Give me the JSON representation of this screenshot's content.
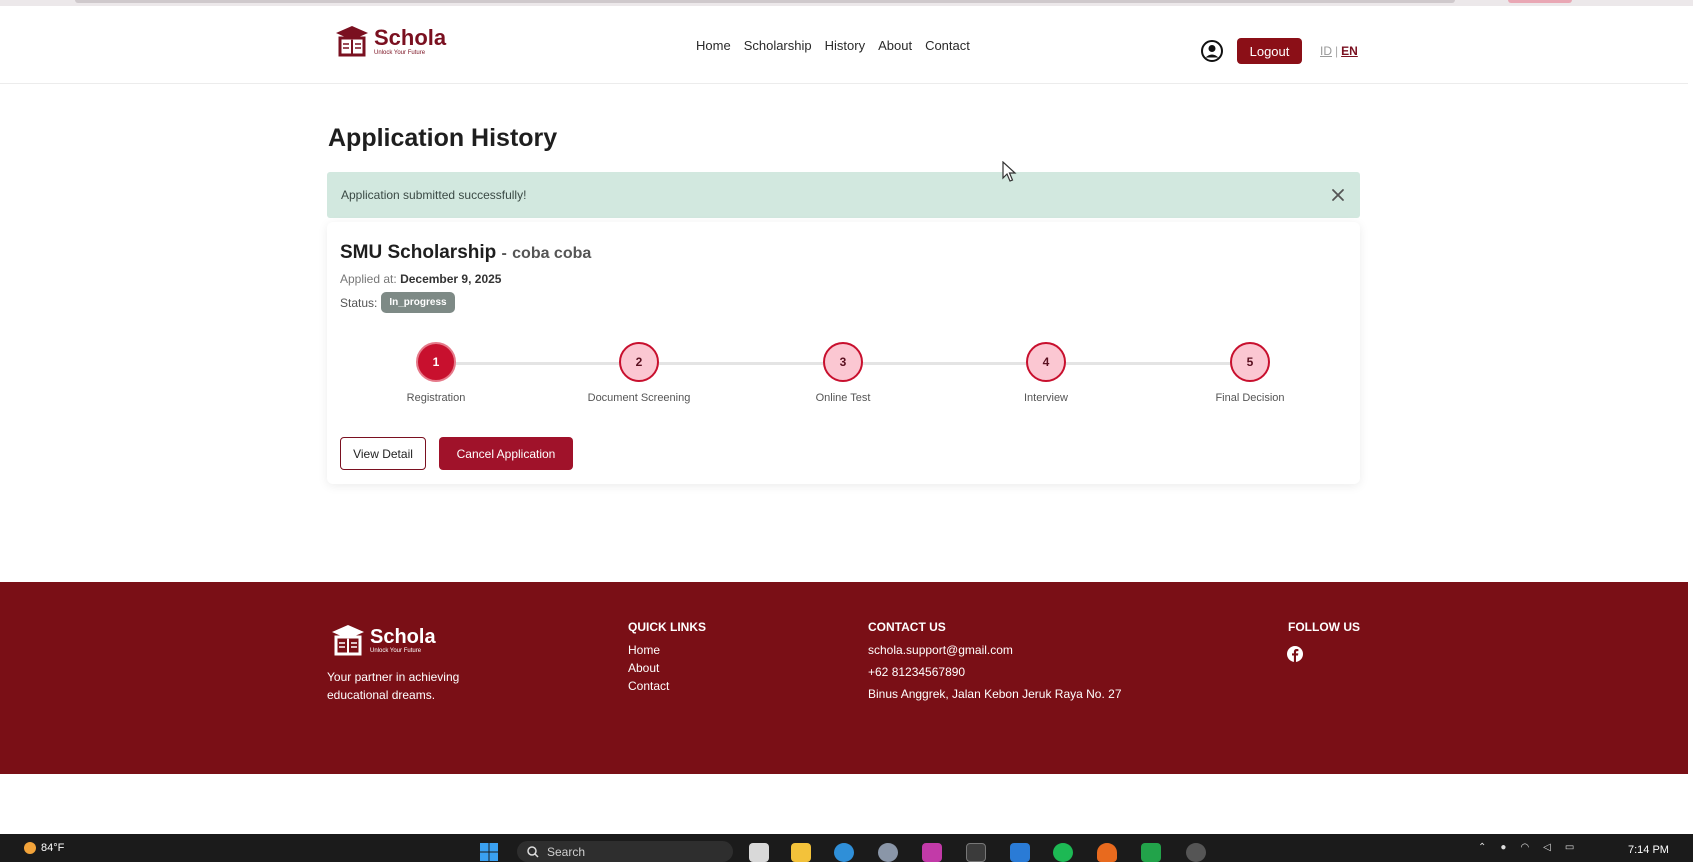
{
  "brand": {
    "name": "Schola",
    "tagline": "Unlock Your Future",
    "color": "#7a1020"
  },
  "nav": {
    "links": [
      "Home",
      "Scholarship",
      "History",
      "About",
      "Contact"
    ],
    "logout_label": "Logout",
    "lang_id": "ID",
    "lang_sep": "|",
    "lang_en": "EN"
  },
  "main": {
    "title": "Application History",
    "alert": {
      "message": "Application submitted successfully!",
      "color": "#d2e8df"
    },
    "application": {
      "scholarship": "SMU Scholarship",
      "dash": "-",
      "program": "coba coba",
      "applied_label": "Applied at:",
      "applied_date": "December 9, 2025",
      "status_label": "Status:",
      "status_value": "In_progress",
      "steps": [
        {
          "number": "1",
          "label": "Registration",
          "state": "active"
        },
        {
          "number": "2",
          "label": "Document Screening",
          "state": "pending"
        },
        {
          "number": "3",
          "label": "Online Test",
          "state": "pending"
        },
        {
          "number": "4",
          "label": "Interview",
          "state": "pending"
        },
        {
          "number": "5",
          "label": "Final Decision",
          "state": "pending"
        }
      ],
      "view_detail_label": "View Detail",
      "cancel_label": "Cancel Application"
    }
  },
  "footer": {
    "tagline": "Your partner in achieving educational dreams.",
    "quick_links_head": "QUICK LINKS",
    "quick_links": [
      "Home",
      "About",
      "Contact"
    ],
    "contact_head": "CONTACT US",
    "email": "schola.support@gmail.com",
    "phone": "+62 81234567890",
    "address": "Binus Anggrek, Jalan Kebon Jeruk Raya No. 27",
    "follow_head": "FOLLOW US",
    "bg_color": "#7a0f16"
  },
  "taskbar": {
    "weather": "84°F",
    "search_placeholder": "Search",
    "time": "7:14 PM"
  }
}
